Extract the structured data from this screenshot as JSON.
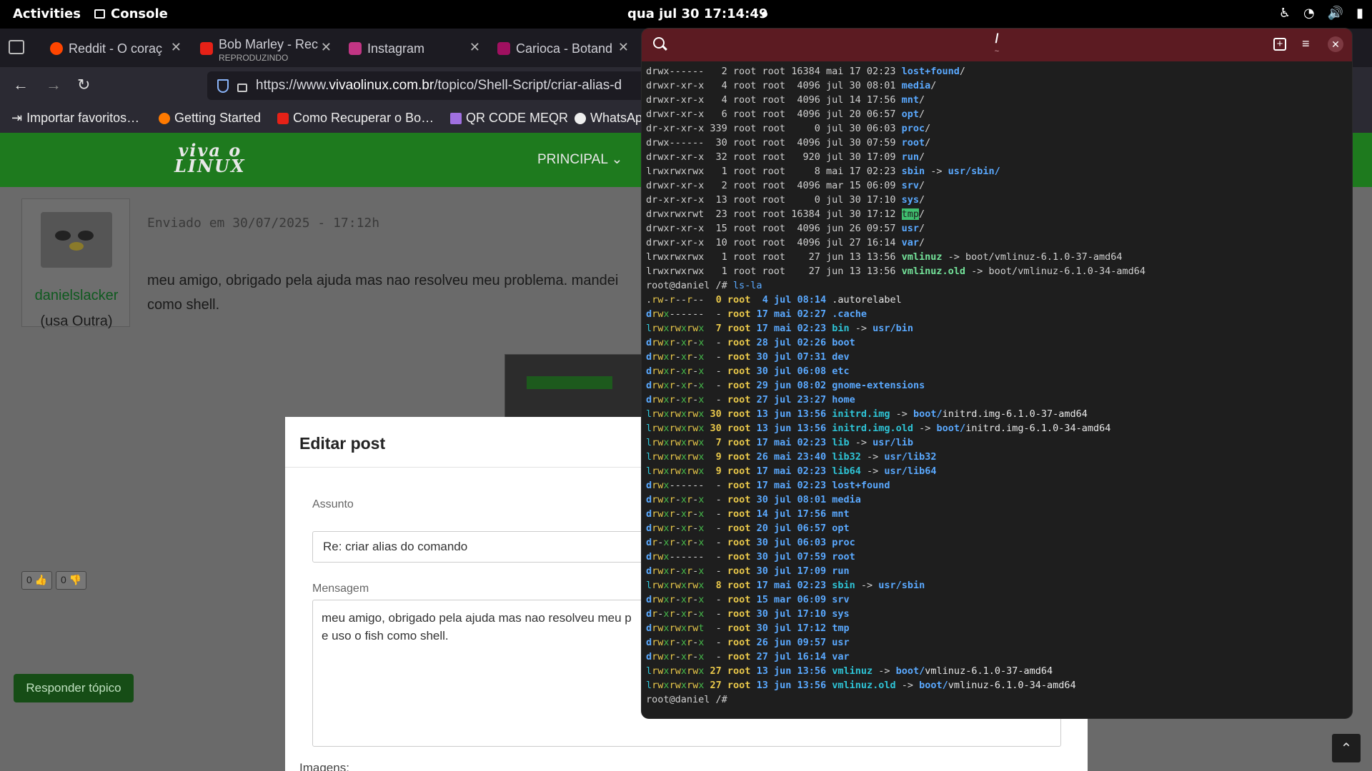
{
  "topbar": {
    "activities": "Activities",
    "app": "Console",
    "clock": "qua jul 30  17:14:49"
  },
  "browser": {
    "tabs": [
      {
        "label": "Reddit - O coraç",
        "sub": "",
        "color": "#ff4500"
      },
      {
        "label": "Bob Marley - Rec",
        "sub": "REPRODUZINDO",
        "color": "#e62117"
      },
      {
        "label": "Instagram",
        "sub": "",
        "color": "#c13584"
      },
      {
        "label": "Carioca - Botand",
        "sub": "",
        "color": "#a01060"
      }
    ],
    "url_prefix": "https://www.",
    "url_host": "vivaolinux.com.br",
    "url_path": "/topico/Shell-Script/criar-alias-d",
    "bookmarks": [
      {
        "label": "Importar favoritos…",
        "color": "#ccc"
      },
      {
        "label": "Getting Started",
        "color": "#ff7a00"
      },
      {
        "label": "Como Recuperar o Bo…",
        "color": "#e62117"
      },
      {
        "label": "QR CODE MEQR",
        "color": "#a070e0"
      },
      {
        "label": "WhatsAp",
        "color": "#eee"
      }
    ]
  },
  "site": {
    "logo_line1": "viva o",
    "logo_line2": "LINUX",
    "menu": "PRINCIPAL ⌄",
    "post_date": "Enviado em 30/07/2025 - 17:12h",
    "post_text_line1": "meu amigo, obrigado pela ajuda mas nao resolveu meu problema. mandei",
    "post_text_line2": "como shell.",
    "author_name": "danielslacker",
    "author_distro": "(usa Outra)",
    "vote_up": "0",
    "vote_down": "0",
    "reply_button": "Responder tópico"
  },
  "modal": {
    "title": "Editar post",
    "subject_label": "Assunto",
    "subject_value": "Re: criar alias do comando",
    "message_label": "Mensagem",
    "message_line1": "meu amigo, obrigado pela ajuda mas nao resolveu meu p",
    "message_line2": "e uso o fish como shell.",
    "images_label": "Imagens:"
  },
  "terminal": {
    "title": "/",
    "subtitle": "~",
    "ls_l": [
      {
        "pre": "drwx------   2 root root 16384 mai 17 02:23 ",
        "name": "lost+found",
        "suffix": "/",
        "target": ""
      },
      {
        "pre": "drwxr-xr-x   4 root root  4096 jul 30 08:01 ",
        "name": "media",
        "suffix": "/",
        "target": ""
      },
      {
        "pre": "drwxr-xr-x   4 root root  4096 jul 14 17:56 ",
        "name": "mnt",
        "suffix": "/",
        "target": ""
      },
      {
        "pre": "drwxr-xr-x   6 root root  4096 jul 20 06:57 ",
        "name": "opt",
        "suffix": "/",
        "target": ""
      },
      {
        "pre": "dr-xr-xr-x 339 root root     0 jul 30 06:03 ",
        "name": "proc",
        "suffix": "/",
        "target": ""
      },
      {
        "pre": "drwx------  30 root root  4096 jul 30 07:59 ",
        "name": "root",
        "suffix": "/",
        "target": ""
      },
      {
        "pre": "drwxr-xr-x  32 root root   920 jul 30 17:09 ",
        "name": "run",
        "suffix": "/",
        "target": ""
      },
      {
        "pre": "lrwxrwxrwx   1 root root     8 mai 17 02:23 ",
        "name": "sbin",
        "suffix": " -> ",
        "target": "usr/sbin/"
      },
      {
        "pre": "drwxr-xr-x   2 root root  4096 mar 15 06:09 ",
        "name": "srv",
        "suffix": "/",
        "target": ""
      },
      {
        "pre": "dr-xr-xr-x  13 root root     0 jul 30 17:10 ",
        "name": "sys",
        "suffix": "/",
        "target": ""
      },
      {
        "pre": "drwxrwxrwt  23 root root 16384 jul 30 17:12 ",
        "name": "tmp",
        "suffix": "/",
        "target": "",
        "hl": true
      },
      {
        "pre": "drwxr-xr-x  15 root root  4096 jun 26 09:57 ",
        "name": "usr",
        "suffix": "/",
        "target": ""
      },
      {
        "pre": "drwxr-xr-x  10 root root  4096 jul 27 16:14 ",
        "name": "var",
        "suffix": "/",
        "target": ""
      },
      {
        "pre": "lrwxrwxrwx   1 root root    27 jun 13 13:56 ",
        "name": "vmlinuz",
        "suffix": " -> ",
        "target": "boot/vmlinuz-6.1.0-37-amd64",
        "link": true
      },
      {
        "pre": "lrwxrwxrwx   1 root root    27 jun 13 13:56 ",
        "name": "vmlinuz.old",
        "suffix": " -> ",
        "target": "boot/vmlinuz-6.1.0-34-amd64",
        "link": true
      }
    ],
    "prompt": "root@daniel /# ",
    "command": "ls-la",
    "exa": [
      {
        "perm": ".rw-r--r--",
        "links": " 0",
        "user": "root",
        "date": "  4 jul 08:14",
        "name": ".autorelabel",
        "kind": "file",
        "target": ""
      },
      {
        "perm": "drwx------",
        "links": " -",
        "user": "root",
        "date": " 17 mai 02:27",
        "name": ".cache",
        "kind": "dir",
        "target": ""
      },
      {
        "perm": "lrwxrwxrwx",
        "links": " 7",
        "user": "root",
        "date": " 17 mai 02:23",
        "name": "bin",
        "kind": "link",
        "target": "usr/bin"
      },
      {
        "perm": "drwxr-xr-x",
        "links": " -",
        "user": "root",
        "date": " 28 jul 02:26",
        "name": "boot",
        "kind": "dir",
        "target": ""
      },
      {
        "perm": "drwxr-xr-x",
        "links": " -",
        "user": "root",
        "date": " 30 jul 07:31",
        "name": "dev",
        "kind": "dir",
        "target": ""
      },
      {
        "perm": "drwxr-xr-x",
        "links": " -",
        "user": "root",
        "date": " 30 jul 06:08",
        "name": "etc",
        "kind": "dir",
        "target": ""
      },
      {
        "perm": "drwxr-xr-x",
        "links": " -",
        "user": "root",
        "date": " 29 jun 08:02",
        "name": "gnome-extensions",
        "kind": "dir",
        "target": ""
      },
      {
        "perm": "drwxr-xr-x",
        "links": " -",
        "user": "root",
        "date": " 27 jul 23:27",
        "name": "home",
        "kind": "dir",
        "target": ""
      },
      {
        "perm": "lrwxrwxrwx",
        "links": "30",
        "user": "root",
        "date": " 13 jun 13:56",
        "name": "initrd.img",
        "kind": "link",
        "target": "boot/initrd.img-6.1.0-37-amd64"
      },
      {
        "perm": "lrwxrwxrwx",
        "links": "30",
        "user": "root",
        "date": " 13 jun 13:56",
        "name": "initrd.img.old",
        "kind": "link",
        "target": "boot/initrd.img-6.1.0-34-amd64"
      },
      {
        "perm": "lrwxrwxrwx",
        "links": " 7",
        "user": "root",
        "date": " 17 mai 02:23",
        "name": "lib",
        "kind": "link",
        "target": "usr/lib"
      },
      {
        "perm": "lrwxrwxrwx",
        "links": " 9",
        "user": "root",
        "date": " 26 mai 23:40",
        "name": "lib32",
        "kind": "link",
        "target": "usr/lib32"
      },
      {
        "perm": "lrwxrwxrwx",
        "links": " 9",
        "user": "root",
        "date": " 17 mai 02:23",
        "name": "lib64",
        "kind": "link",
        "target": "usr/lib64"
      },
      {
        "perm": "drwx------",
        "links": " -",
        "user": "root",
        "date": " 17 mai 02:23",
        "name": "lost+found",
        "kind": "dir",
        "target": ""
      },
      {
        "perm": "drwxr-xr-x",
        "links": " -",
        "user": "root",
        "date": " 30 jul 08:01",
        "name": "media",
        "kind": "dir",
        "target": ""
      },
      {
        "perm": "drwxr-xr-x",
        "links": " -",
        "user": "root",
        "date": " 14 jul 17:56",
        "name": "mnt",
        "kind": "dir",
        "target": ""
      },
      {
        "perm": "drwxr-xr-x",
        "links": " -",
        "user": "root",
        "date": " 20 jul 06:57",
        "name": "opt",
        "kind": "dir",
        "target": ""
      },
      {
        "perm": "dr-xr-xr-x",
        "links": " -",
        "user": "root",
        "date": " 30 jul 06:03",
        "name": "proc",
        "kind": "dir",
        "target": ""
      },
      {
        "perm": "drwx------",
        "links": " -",
        "user": "root",
        "date": " 30 jul 07:59",
        "name": "root",
        "kind": "dir",
        "target": ""
      },
      {
        "perm": "drwxr-xr-x",
        "links": " -",
        "user": "root",
        "date": " 30 jul 17:09",
        "name": "run",
        "kind": "dir",
        "target": ""
      },
      {
        "perm": "lrwxrwxrwx",
        "links": " 8",
        "user": "root",
        "date": " 17 mai 02:23",
        "name": "sbin",
        "kind": "link",
        "target": "usr/sbin"
      },
      {
        "perm": "drwxr-xr-x",
        "links": " -",
        "user": "root",
        "date": " 15 mar 06:09",
        "name": "srv",
        "kind": "dir",
        "target": ""
      },
      {
        "perm": "dr-xr-xr-x",
        "links": " -",
        "user": "root",
        "date": " 30 jul 17:10",
        "name": "sys",
        "kind": "dir",
        "target": ""
      },
      {
        "perm": "drwxrwxrwt",
        "links": " -",
        "user": "root",
        "date": " 30 jul 17:12",
        "name": "tmp",
        "kind": "dir",
        "target": ""
      },
      {
        "perm": "drwxr-xr-x",
        "links": " -",
        "user": "root",
        "date": " 26 jun 09:57",
        "name": "usr",
        "kind": "dir",
        "target": ""
      },
      {
        "perm": "drwxr-xr-x",
        "links": " -",
        "user": "root",
        "date": " 27 jul 16:14",
        "name": "var",
        "kind": "dir",
        "target": ""
      },
      {
        "perm": "lrwxrwxrwx",
        "links": "27",
        "user": "root",
        "date": " 13 jun 13:56",
        "name": "vmlinuz",
        "kind": "link",
        "target": "boot/vmlinuz-6.1.0-37-amd64"
      },
      {
        "perm": "lrwxrwxrwx",
        "links": "27",
        "user": "root",
        "date": " 13 jun 13:56",
        "name": "vmlinuz.old",
        "kind": "link",
        "target": "boot/vmlinuz-6.1.0-34-amd64"
      }
    ],
    "final_prompt": "root@daniel /# "
  }
}
